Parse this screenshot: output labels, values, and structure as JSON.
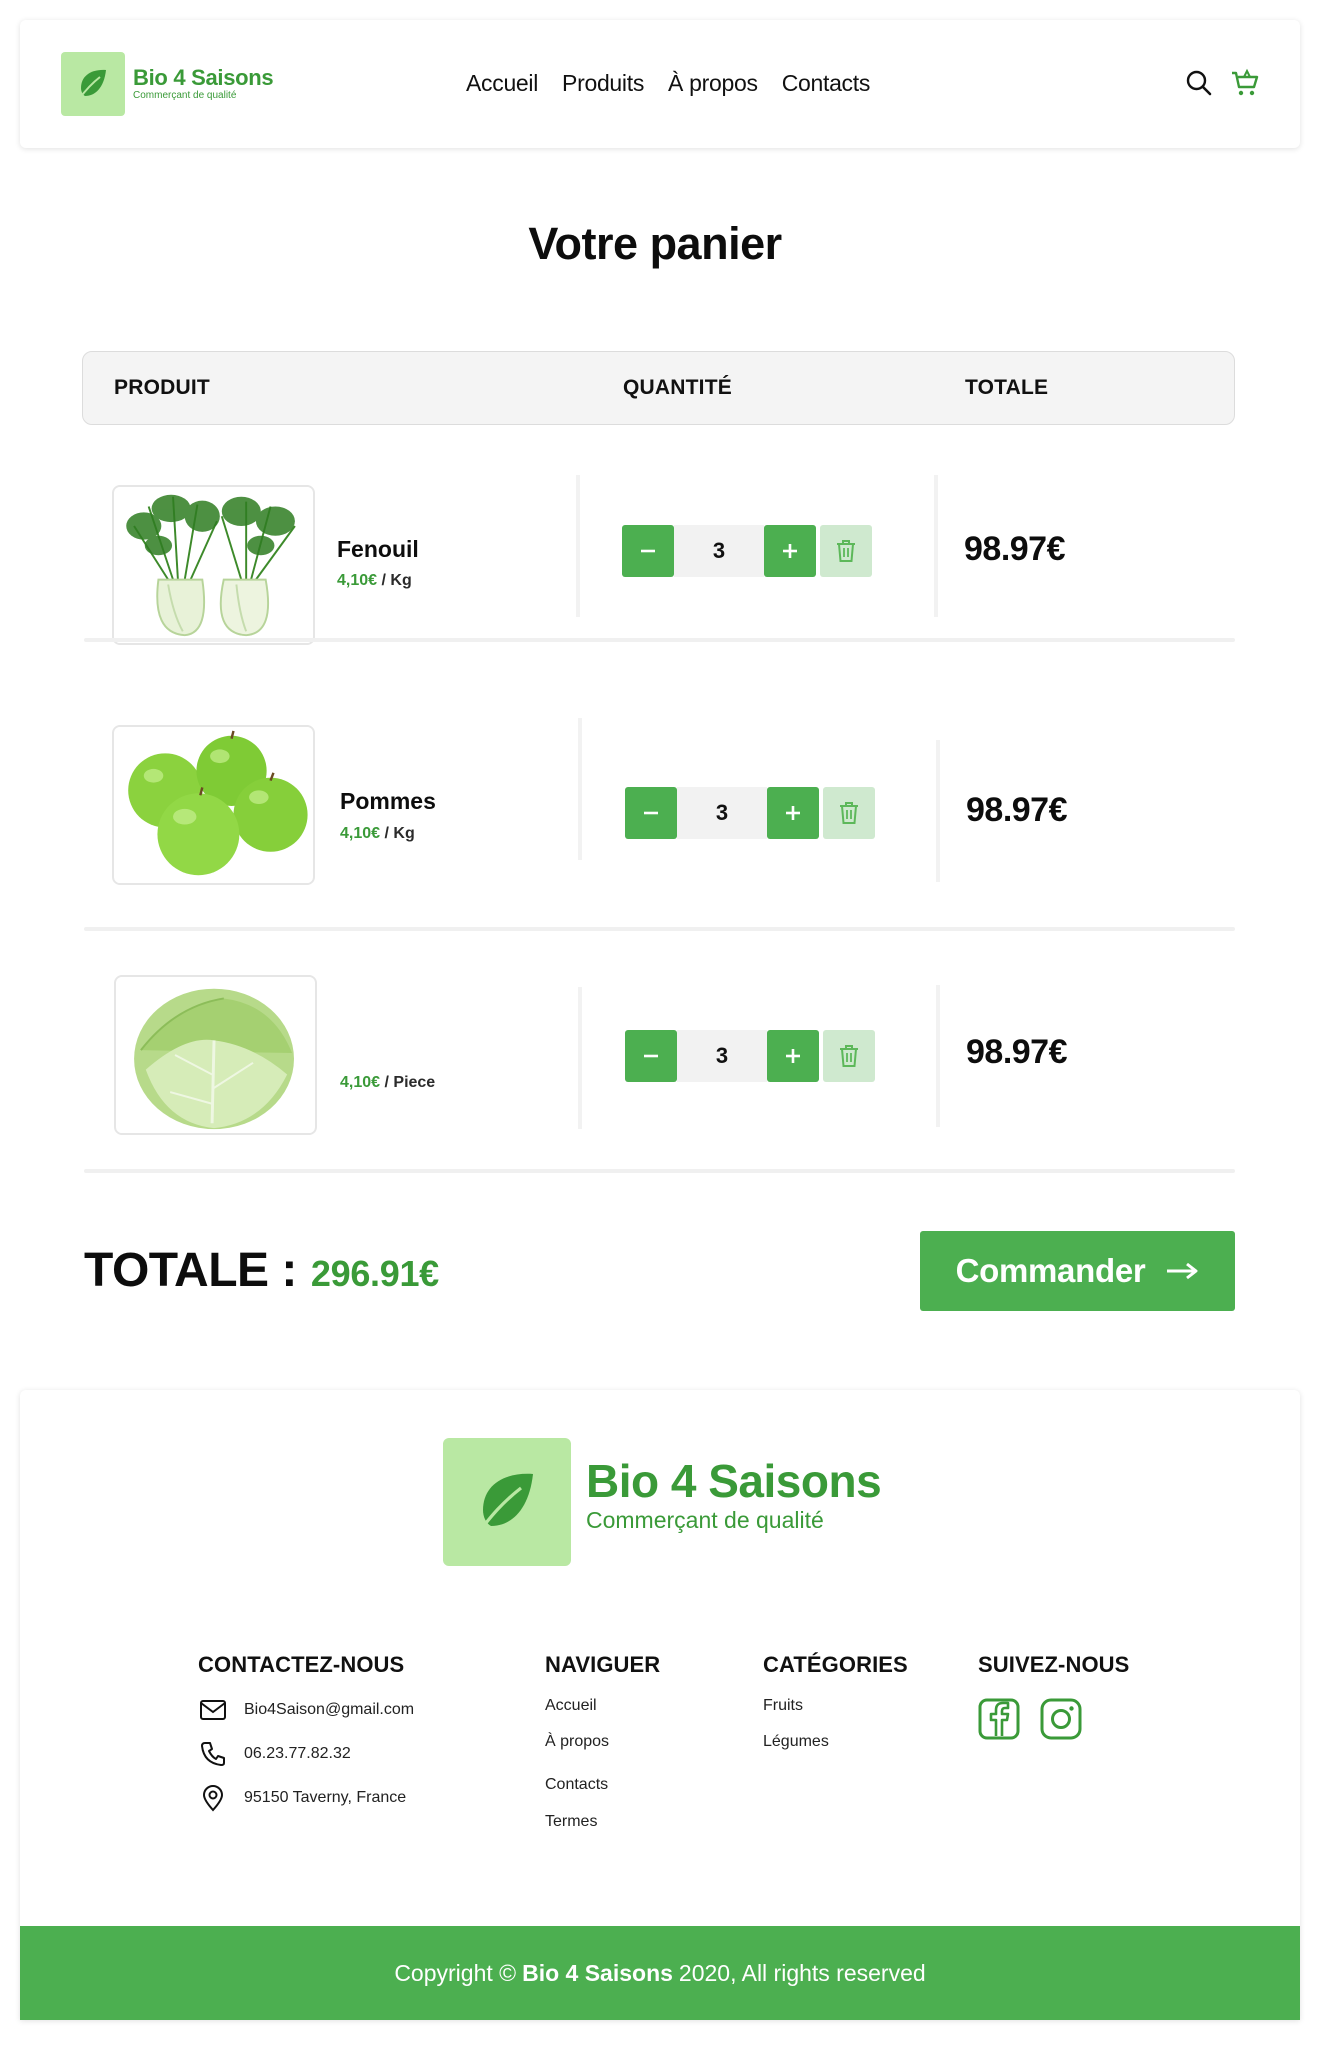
{
  "header": {
    "brand_name": "Bio 4 Saisons",
    "brand_tagline": "Commerçant de qualité",
    "nav": [
      "Accueil",
      "Produits",
      "À propos",
      "Contacts"
    ],
    "icons": [
      "search-icon",
      "cart-icon"
    ]
  },
  "page_title": "Votre panier",
  "table": {
    "columns": [
      "PRODUIT",
      "QUANTITÉ",
      "TOTALE"
    ]
  },
  "cart": [
    {
      "name": "Fenouil",
      "price": "4,10€",
      "unit": "/ Kg",
      "quantity": "3",
      "total": "98.97€",
      "image": "fennel"
    },
    {
      "name": "Pommes",
      "price": "4,10€",
      "unit": "/ Kg",
      "quantity": "3",
      "total": "98.97€",
      "image": "green-apples"
    },
    {
      "name": "",
      "price": "4,10€",
      "unit": "/ Piece",
      "quantity": "3",
      "total": "98.97€",
      "image": "cabbage"
    }
  ],
  "summary": {
    "label": "TOTALE :",
    "amount": "296.91€",
    "order_button": "Commander"
  },
  "footer": {
    "brand_name": "Bio 4 Saisons",
    "brand_tagline": "Commerçant de qualité",
    "contact": {
      "title": "CONTACTEZ-NOUS",
      "email": "Bio4Saison@gmail.com",
      "phone": "06.23.77.82.32",
      "address": "95150 Taverny, France"
    },
    "navigate": {
      "title": "NAVIGUER",
      "links": [
        "Accueil",
        "À propos",
        "Contacts",
        "Termes"
      ]
    },
    "categories": {
      "title": "CATÉGORIES",
      "links": [
        "Fruits",
        "Légumes"
      ]
    },
    "follow": {
      "title": "SUIVEZ-NOUS",
      "icons": [
        "facebook-icon",
        "instagram-icon"
      ]
    },
    "copyright_prefix": "Copyright ©",
    "copyright_brand": "Bio 4 Saisons",
    "copyright_suffix": "2020, All rights reserved"
  },
  "colors": {
    "accent": "#4caf50",
    "brand_text": "#3a9a38",
    "brand_tile": "#b9e8a3",
    "delete_bg": "#cfe9cf"
  }
}
